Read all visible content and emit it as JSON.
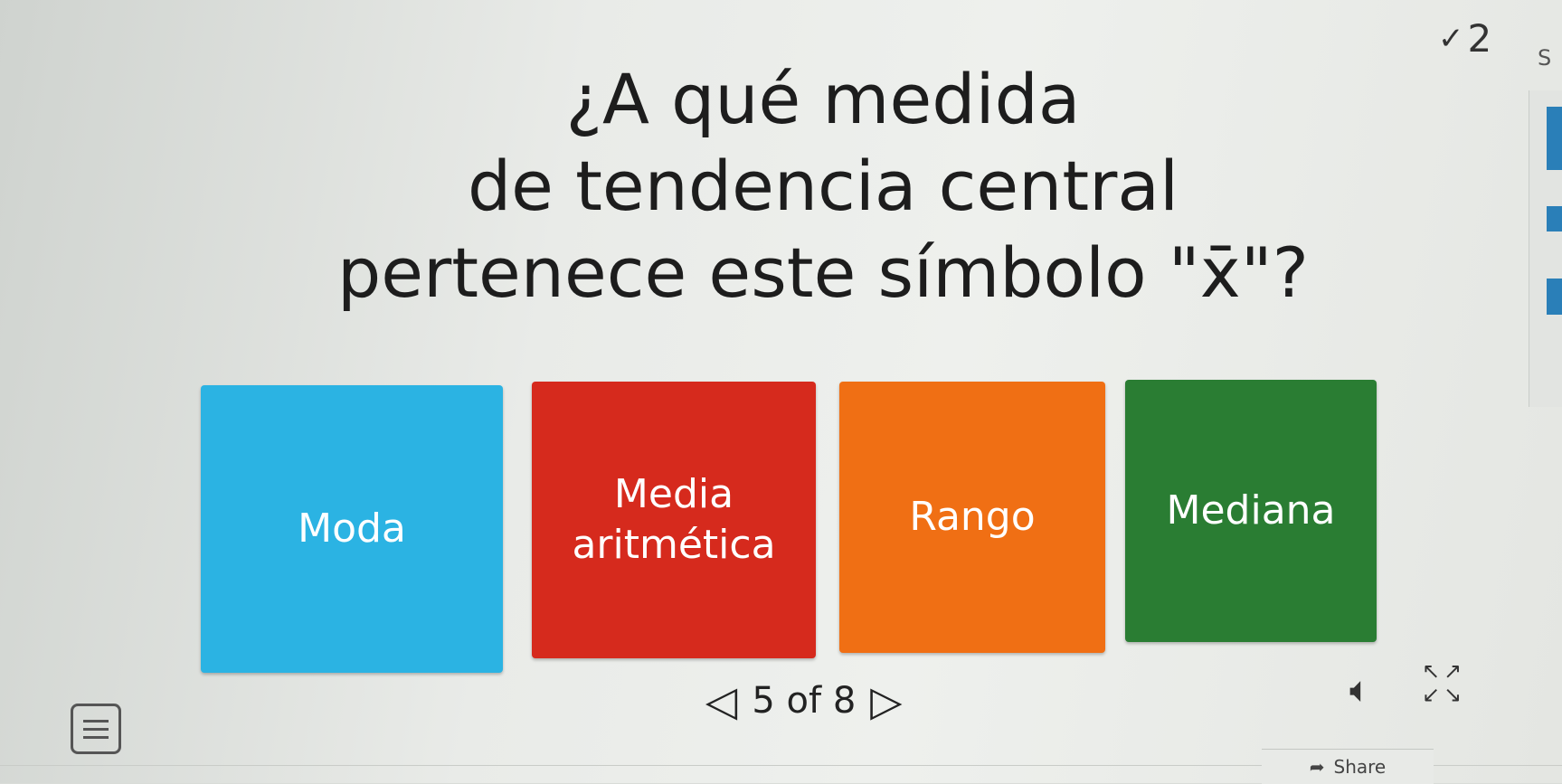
{
  "header": {
    "score_icon": "check-icon",
    "score_value": "2",
    "side_letter": "S"
  },
  "question": {
    "line1": "¿A qué medida",
    "line2": "de tendencia central",
    "line3": "pertenece este símbolo \"x̄\"?"
  },
  "answers": [
    {
      "label_line1": "Moda",
      "label_line2": "",
      "color": "#2bb3e3"
    },
    {
      "label_line1": "Media",
      "label_line2": "aritmética",
      "color": "#d62a1d"
    },
    {
      "label_line1": "Rango",
      "label_line2": "",
      "color": "#f06f14"
    },
    {
      "label_line1": "Mediana",
      "label_line2": "",
      "color": "#2a7d33"
    }
  ],
  "nav": {
    "counter": "5 of 8",
    "prev_icon": "triangle-left-icon",
    "next_icon": "triangle-right-icon"
  },
  "toolbar": {
    "share_label": "Share",
    "audio_icon": "speaker-icon",
    "fullscreen_icon": "fullscreen-icon",
    "menu_icon": "menu-icon"
  },
  "colors": {
    "background": "#e9ebe8",
    "side_accent": "#2a7fb8"
  }
}
